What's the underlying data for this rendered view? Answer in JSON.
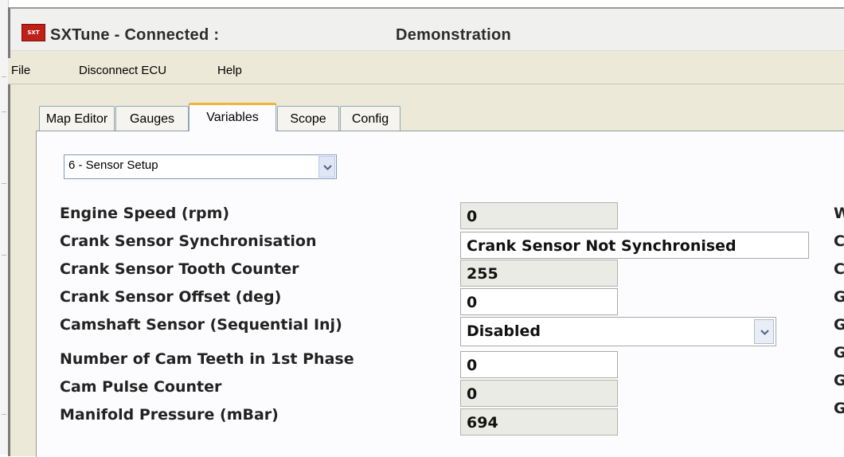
{
  "window": {
    "logo_text": "SXT",
    "title_app": "SXTune - Connected :",
    "title_doc": "Demonstration"
  },
  "menu": [
    "File",
    "Disconnect ECU",
    "Help"
  ],
  "tabs": [
    {
      "label": "Map Editor",
      "active": false
    },
    {
      "label": "Gauges",
      "active": false
    },
    {
      "label": "Variables",
      "active": true
    },
    {
      "label": "Scope",
      "active": false
    },
    {
      "label": "Config",
      "active": false
    }
  ],
  "page_select": {
    "value": "6 - Sensor Setup"
  },
  "variables": [
    {
      "label": "Engine Speed (rpm)",
      "value": "0",
      "editable": false
    },
    {
      "label": "Crank Sensor Synchronisation",
      "value": "Crank Sensor Not Synchronised",
      "editable": true
    },
    {
      "label": "Crank Sensor Tooth Counter",
      "value": "255",
      "editable": false
    },
    {
      "label": "Crank Sensor Offset (deg)",
      "value": "0",
      "editable": true
    },
    {
      "label": "Camshaft Sensor (Sequential Inj)",
      "value": "Disabled",
      "editable": true
    },
    {
      "label": "Number of Cam Teeth in 1st Phase",
      "value": "0",
      "editable": true
    },
    {
      "label": "Cam Pulse Counter",
      "value": "0",
      "editable": false
    },
    {
      "label": "Manifold Pressure (mBar)",
      "value": "694",
      "editable": false
    }
  ],
  "right_column_letters": [
    "W",
    "C",
    "C",
    "G",
    "G",
    "G",
    "G",
    "G"
  ],
  "colors": {
    "active_tab_accent": "#f2b43b",
    "logo_red": "#c0201a",
    "readonly_field_bg": "#ebebe6",
    "editable_field_bg": "#ffffff"
  },
  "icons": {
    "dropdown": "chevron-down-icon",
    "logo": "sxtune-logo-icon"
  }
}
